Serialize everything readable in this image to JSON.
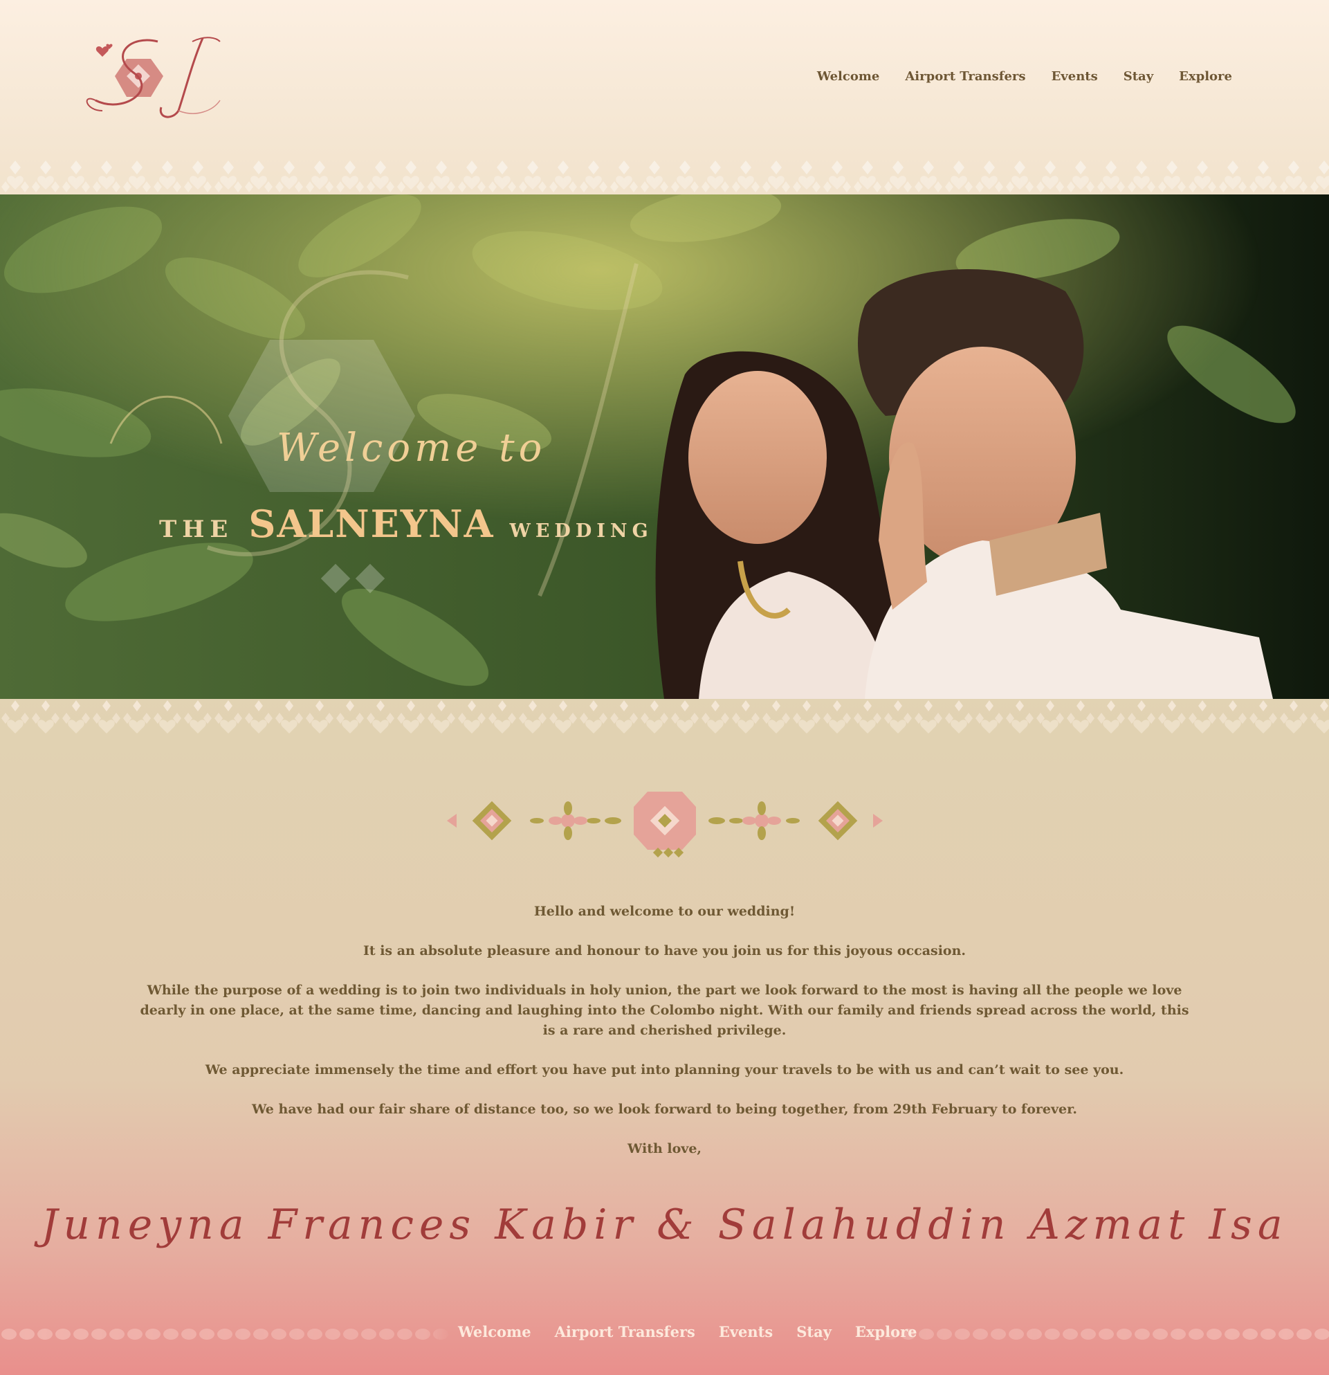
{
  "header": {
    "logo_letters": "SI",
    "nav": [
      {
        "label": "Welcome"
      },
      {
        "label": "Airport Transfers"
      },
      {
        "label": "Events"
      },
      {
        "label": "Stay"
      },
      {
        "label": "Explore"
      }
    ]
  },
  "hero": {
    "script_line": "Welcome to",
    "the": "THE",
    "name": "SALNEYNA",
    "wedding": "WEDDING"
  },
  "message": {
    "paragraphs": [
      "Hello and welcome to our wedding!",
      "It is an absolute pleasure and honour to have you join us for this joyous occasion.",
      "While the purpose of a wedding is to join two individuals in holy union, the part we look forward to the most is having all the people we love dearly in one place, at the same time, dancing and laughing into the Colombo night. With our family and friends spread across the world, this is a rare and cherished privilege.",
      "We appreciate immensely the time and effort you have put into planning your travels to be with us and can’t wait to see you.",
      "We have had our fair share of distance too, so we look forward to being together, from 29th February to forever.",
      "With love,"
    ],
    "signature": "Juneyna Frances Kabir & Salahuddin Azmat Isa"
  },
  "footer": {
    "nav": [
      {
        "label": "Welcome"
      },
      {
        "label": "Airport Transfers"
      },
      {
        "label": "Events"
      },
      {
        "label": "Stay"
      },
      {
        "label": "Explore"
      }
    ]
  },
  "colors": {
    "nav_text": "#6e5735",
    "body_text": "#6f5934",
    "signature": "#a13c3a",
    "accent_pink": "#e5a399",
    "accent_olive": "#b3a24c",
    "hero_gold": "#f0d2a0"
  }
}
